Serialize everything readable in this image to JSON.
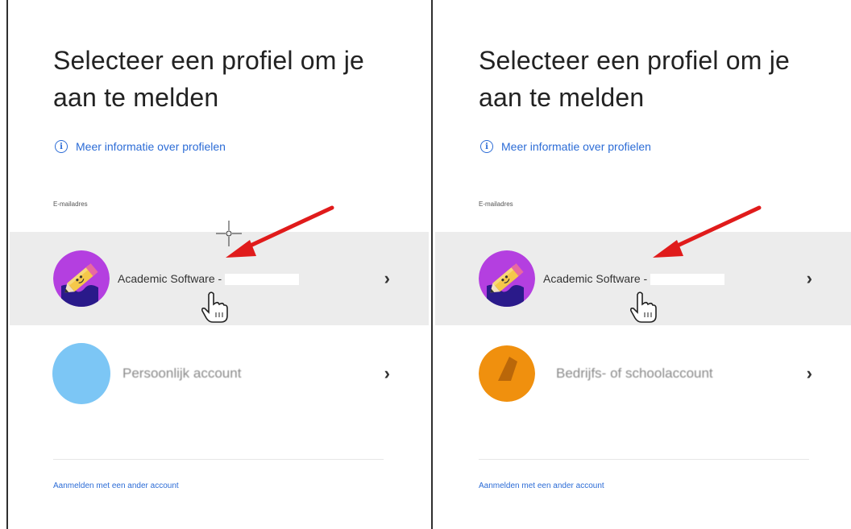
{
  "left": {
    "title": "Selecteer een profiel om je aan te melden",
    "info_link": "Meer informatie over profielen",
    "email_label": "E-mailadres",
    "profiles": [
      {
        "name": "Academic Software -",
        "avatar": "pencil-avatar-icon"
      },
      {
        "name": "Persoonlijk account",
        "avatar": "blue-circle-avatar"
      }
    ],
    "alt_link": "Aanmelden met een ander account"
  },
  "right": {
    "title": "Selecteer een profiel om je aan te melden",
    "info_link": "Meer informatie over profielen",
    "email_label": "E-mailadres",
    "profiles": [
      {
        "name": "Academic Software -",
        "avatar": "pencil-avatar-icon"
      },
      {
        "name": "Bedrijfs- of schoolaccount",
        "avatar": "orange-pie-avatar"
      }
    ],
    "alt_link": "Aanmelden met een ander account"
  },
  "colors": {
    "link": "#2c6cd6",
    "selected_row": "#ececec",
    "pencil_avatar_bg": "#b43fe0",
    "blue_avatar": "#7cc6f5",
    "orange_avatar": "#f0900e",
    "annotation_arrow": "#e01b1b"
  }
}
